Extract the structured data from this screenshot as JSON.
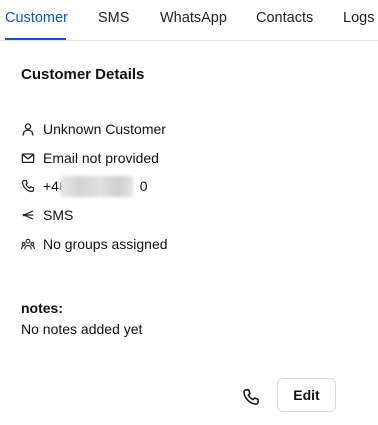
{
  "tabs": [
    {
      "label": "Customer",
      "active": true
    },
    {
      "label": "SMS",
      "active": false
    },
    {
      "label": "WhatsApp",
      "active": false
    },
    {
      "label": "Contacts",
      "active": false
    },
    {
      "label": "Logs",
      "active": false
    }
  ],
  "details": {
    "title": "Customer Details",
    "rows": [
      {
        "icon": "user-icon",
        "text": "Unknown Customer"
      },
      {
        "icon": "mail-icon",
        "text": "Email not provided"
      },
      {
        "icon": "phone-icon",
        "prefix": "+48",
        "suffix": "0"
      },
      {
        "icon": "share-icon",
        "text": "SMS"
      },
      {
        "icon": "group-icon",
        "text": "No groups assigned"
      }
    ]
  },
  "notes": {
    "label": "notes:",
    "value": "No notes added yet"
  },
  "actions": {
    "call_icon": "phone-icon",
    "edit_label": "Edit"
  },
  "colors": {
    "accent": "#0b57d0",
    "text": "#111111",
    "border": "#d9d9d9"
  }
}
